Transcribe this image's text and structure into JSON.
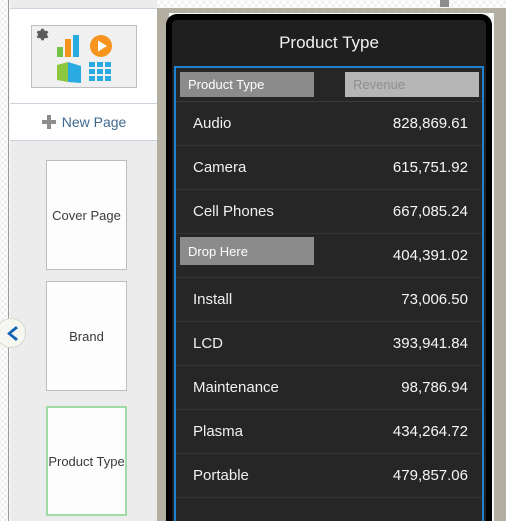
{
  "sidebar": {
    "master_thumbnail": {
      "name": "master-page-thumbnail",
      "gear_icon": "gear-icon",
      "icons": [
        "bar-chart-icon",
        "play-icon",
        "book-icon",
        "grid-icon"
      ]
    },
    "new_page": {
      "label": "New Page",
      "icon": "plus-icon"
    },
    "collapse": {
      "icon": "chevron-left-icon"
    },
    "pages": [
      {
        "label": "Cover Page",
        "selected": false
      },
      {
        "label": "Brand",
        "selected": false
      },
      {
        "label": "Product Type",
        "selected": true
      }
    ]
  },
  "panel": {
    "title": "Product Type",
    "header": {
      "dimension_chip": "Product Type",
      "measure_chip": "Revenue"
    },
    "drop_placeholder": "Drop Here",
    "drop_row_index": 3,
    "colors": {
      "selection_blue": "#1a83d6",
      "panel_bg": "#262626",
      "frame_black": "#000000",
      "chip_gray": "#8b8b8b",
      "chip_light_gray": "#b6b6b6",
      "selected_page_green": "#9fdba4",
      "link_blue": "#40688f",
      "gutter_beige": "#b2aea2"
    }
  },
  "table": {
    "columns": [
      "Product Type",
      "Revenue"
    ],
    "rows": [
      {
        "label": "Audio",
        "value": "828,869.61"
      },
      {
        "label": "Camera",
        "value": "615,751.92"
      },
      {
        "label": "Cell Phones",
        "value": "667,085.24"
      },
      {
        "label": "",
        "value": "404,391.02"
      },
      {
        "label": "Install",
        "value": "73,006.50"
      },
      {
        "label": "LCD",
        "value": "393,941.84"
      },
      {
        "label": "Maintenance",
        "value": "98,786.94"
      },
      {
        "label": "Plasma",
        "value": "434,264.72"
      },
      {
        "label": "Portable",
        "value": "479,857.06"
      }
    ]
  }
}
